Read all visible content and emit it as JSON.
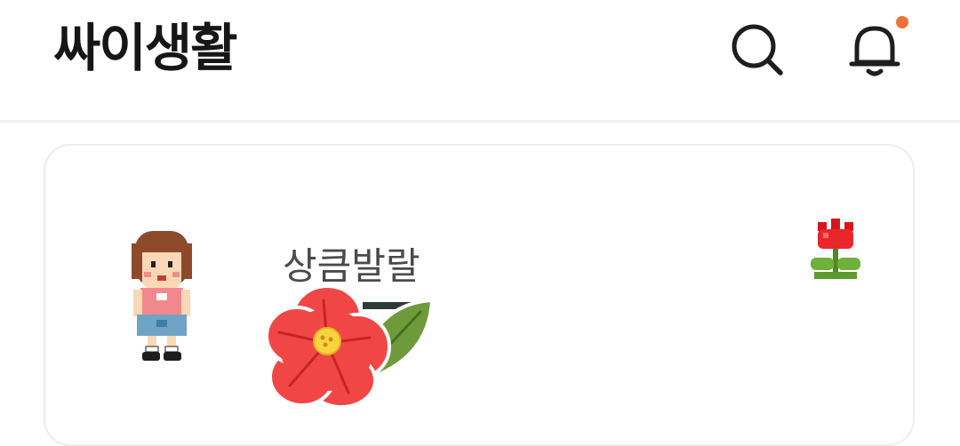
{
  "header": {
    "title": "싸이생활",
    "search_icon": "search-icon",
    "bell_icon": "bell-icon",
    "notification_dot_color": "#ef6f36"
  },
  "profile_card": {
    "nickname": "상큼발랄",
    "avatar": "pixel-girl-avatar",
    "mood_icon": "pixel-tulip-icon",
    "sticker": "red-flower-sticker"
  }
}
